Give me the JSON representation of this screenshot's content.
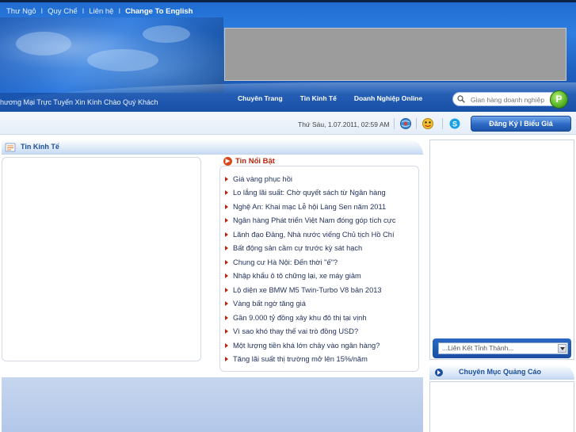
{
  "top_menu": {
    "items": [
      "Thư Ngỏ",
      "Quy Chế",
      "Liên hệ"
    ],
    "separator": "I",
    "language_link": "Change To English"
  },
  "marquee_text": "hương Mại Trực Tuyến Xin Kính Chào Quý Khách",
  "main_nav": {
    "items": [
      "Chuyên Trang",
      "Tin Kinh Tế",
      "Doanh Nghiệp Online"
    ]
  },
  "search": {
    "placeholder": "Gian hàng doanh nghiệp",
    "button_label": "P"
  },
  "toolbar": {
    "datetime": "Thứ Sáu, 1.07.2011, 02:59 AM",
    "icons": [
      "globe-icon",
      "messenger-icon",
      "skype-icon"
    ],
    "register_button": "Đăng Ký  I  Biểu Giá"
  },
  "section": {
    "title": "Tin Kinh Tế"
  },
  "featured_news": {
    "title": "Tin Nổi Bật",
    "items": [
      "Giá vàng phục hồi",
      "Lo lắng lãi suất: Chờ quyết sách từ Ngân hàng",
      "Nghệ An: Khai mạc Lễ hội Làng Sen năm 2011",
      "Ngân hàng Phát triển Việt Nam đóng góp tích cực",
      "Lãnh đạo Đảng, Nhà nước viếng Chủ tịch Hồ Chí",
      "Bất động sản cầm cự trước kỳ sát hạch",
      "Chung cư Hà Nội: Đến thời \"ế\"?",
      "Nhập khẩu ô tô chững lại, xe máy giảm",
      "Lộ diện xe BMW M5 Twin-Turbo V8 bản 2013",
      "Vàng bất ngờ tăng giá",
      "Gần 9.000 tỷ đồng xây khu đô thị tại vịnh",
      "Vì sao khó thay thế vai trò đồng USD?",
      "Một lượng tiền khá lớn chảy vào ngân hàng?",
      "Tăng lãi suất thị trường mở lên 15%/năm"
    ]
  },
  "sidebar": {
    "province_select": "...Liên Kết Tỉnh Thành...",
    "ads_title": "Chuyên Mục Quảng Cáo"
  },
  "colors": {
    "header_blue": "#1f6bd0",
    "accent_red": "#b8260e",
    "nav_text": "#1b4f9a"
  }
}
